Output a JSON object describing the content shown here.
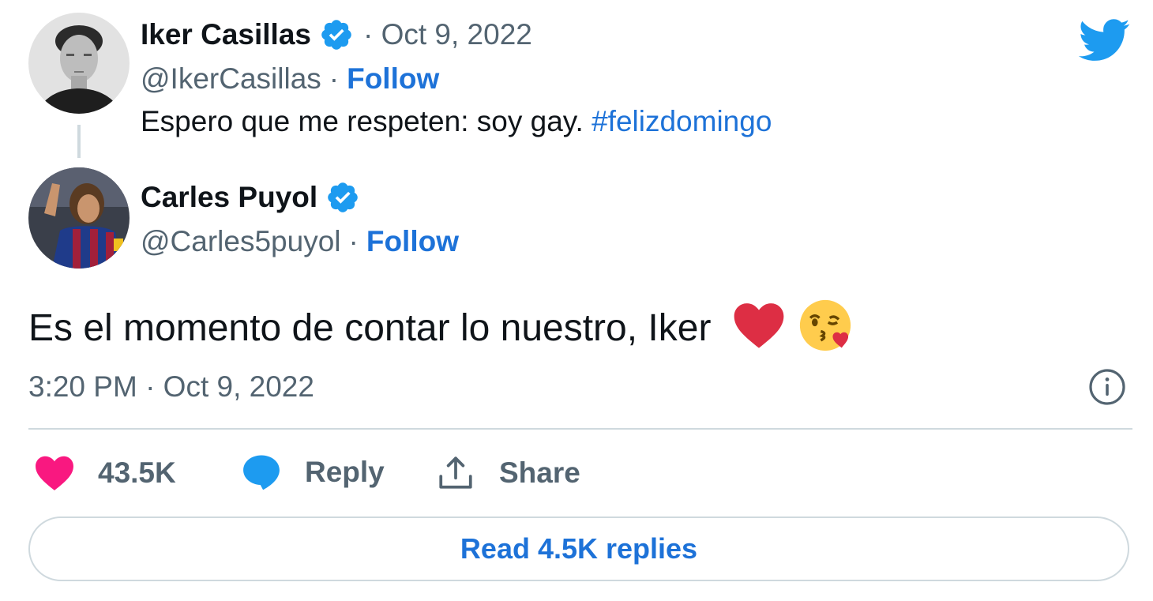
{
  "quoted_tweet": {
    "author_name": "Iker Casillas",
    "date": "· Oct 9, 2022",
    "handle": "@IkerCasillas",
    "separator": "·",
    "follow_label": "Follow",
    "text": "Espero que me respeten: soy gay.",
    "hashtag": "#felizdomingo"
  },
  "main_tweet": {
    "author_name": "Carles Puyol",
    "handle": "@Carles5puyol",
    "separator": "·",
    "follow_label": "Follow",
    "text": "Es el momento de contar lo nuestro, Iker",
    "emojis": [
      "red-heart",
      "face-blowing-kiss"
    ],
    "timestamp": "3:20 PM · Oct 9, 2022"
  },
  "actions": {
    "like_count": "43.5K",
    "reply_label": "Reply",
    "share_label": "Share"
  },
  "read_replies_label": "Read 4.5K replies",
  "icons": {
    "brand": "twitter-bird-icon",
    "verified": "verified-badge-icon",
    "info": "info-icon",
    "like": "heart-icon",
    "reply": "speech-bubble-icon",
    "share": "share-upload-icon"
  },
  "colors": {
    "accent": "#1d9bf0",
    "link": "#1d72d8",
    "like": "#f91880",
    "muted": "#536471",
    "text": "#0f1419",
    "border": "#cfd9de"
  }
}
